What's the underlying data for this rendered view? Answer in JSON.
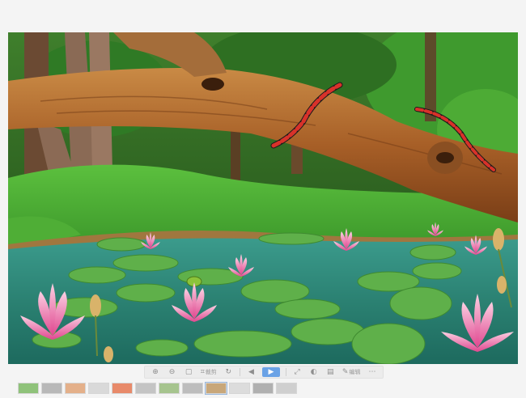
{
  "image": {
    "alt": ""
  },
  "toolbar": {
    "buttons": [
      {
        "id": "zoom-in",
        "glyph": "⊕"
      },
      {
        "id": "zoom-out",
        "glyph": "⊖"
      },
      {
        "id": "actual-size",
        "glyph": "▢"
      },
      {
        "id": "crop",
        "glyph": "⌗",
        "label": "裁剪"
      },
      {
        "id": "rotate",
        "glyph": "↻"
      },
      {
        "id": "prev",
        "glyph": "◀"
      },
      {
        "id": "next",
        "glyph": "▶",
        "active": true
      },
      {
        "id": "fullscreen",
        "glyph": "⤢"
      },
      {
        "id": "adjust",
        "glyph": "◐"
      },
      {
        "id": "print",
        "glyph": "▤"
      },
      {
        "id": "edit",
        "glyph": "✎",
        "label": "编辑"
      },
      {
        "id": "more",
        "glyph": "⋯"
      }
    ]
  },
  "filmstrip": {
    "thumbs": [
      {
        "color": "#8fc27a"
      },
      {
        "color": "#b8b8b8"
      },
      {
        "color": "#e4b08a"
      },
      {
        "color": "#d9d9d9"
      },
      {
        "color": "#e88a6a"
      },
      {
        "color": "#c4c4c4"
      },
      {
        "color": "#a6c48e"
      },
      {
        "color": "#bdbdbd"
      },
      {
        "color": "#c8a77a",
        "selected": true
      },
      {
        "color": "#dcdcdc"
      },
      {
        "color": "#b0b0b0"
      },
      {
        "color": "#cfcfcf"
      }
    ]
  },
  "colors": {
    "forest_dark": "#2f6b22",
    "grass": "#52b53a",
    "trunk": "#b06a2c",
    "water": "#2f8a7a",
    "lily_pad": "#5fb04a",
    "lotus": "#f07ab0",
    "snake_red": "#d8322a"
  }
}
